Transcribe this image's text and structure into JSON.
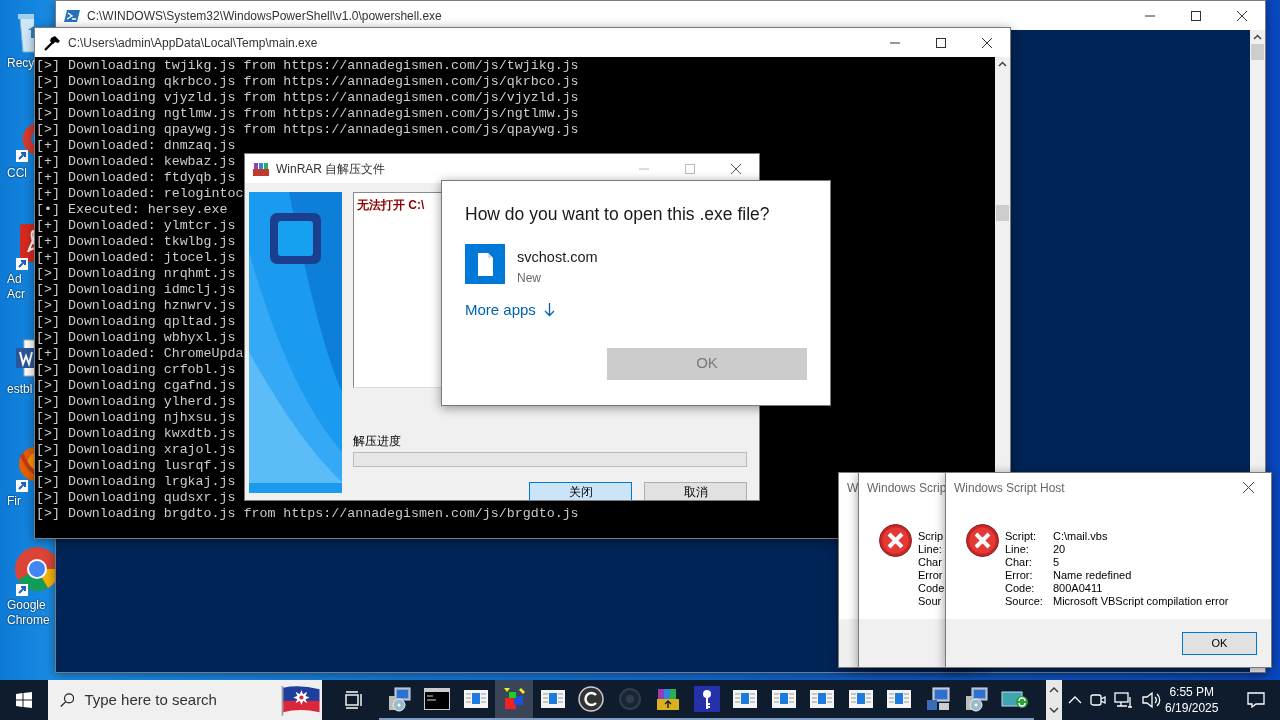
{
  "desktop_icons": [
    {
      "kind": "recycle-bin",
      "lines": [
        "Recy"
      ]
    },
    {
      "kind": "cleaner",
      "lines": [
        "CCl"
      ]
    },
    {
      "kind": "pdf",
      "lines": [
        "Ad",
        "Acr"
      ]
    },
    {
      "kind": "document",
      "lines": [
        "estbl"
      ]
    },
    {
      "kind": "fox",
      "lines": [
        "Fir"
      ]
    },
    {
      "kind": "browser",
      "lines": [
        "Google",
        "Chrome"
      ]
    }
  ],
  "powershell_window": {
    "title": "C:\\WINDOWS\\System32\\WindowsPowerShell\\v1.0\\powershell.exe"
  },
  "console_window": {
    "title": "C:\\Users\\admin\\AppData\\Local\\Temp\\main.exe",
    "lines": [
      "[>] Downloading twjikg.js from https://annadegismen.com/js/twjikg.js",
      "[>] Downloading qkrbco.js from https://annadegismen.com/js/qkrbco.js",
      "[>] Downloading vjyzld.js from https://annadegismen.com/js/vjyzld.js",
      "[>] Downloading ngtlmw.js from https://annadegismen.com/js/ngtlmw.js",
      "[>] Downloading qpaywg.js from https://annadegismen.com/js/qpaywg.js",
      "[+] Downloaded: dnmzaq.js",
      "[+] Downloaded: kewbaz.js",
      "[+] Downloaded: ftdyqb.js",
      "[+] Downloaded: relogintoc",
      "[•] Executed: hersey.exe",
      "[+] Downloaded: ylmtcr.js",
      "[+] Downloaded: tkwlbg.js",
      "[+] Downloaded: jtocel.js",
      "[>] Downloading nrqhmt.js",
      "[>] Downloading idmclj.js",
      "[>] Downloading hznwrv.js",
      "[>] Downloading qpltad.js",
      "[>] Downloading wbhyxl.js",
      "[+] Downloaded: ChromeUpda",
      "[>] Downloading crfobl.js",
      "[>] Downloading cgafnd.js",
      "[>] Downloading ylherd.js",
      "[>] Downloading njhxsu.js",
      "[>] Downloading kwxdtb.js",
      "[>] Downloading xrajol.js",
      "[>] Downloading lusrqf.js",
      "[>] Downloading lrgkaj.js",
      "[>] Downloading qudsxr.js",
      "[>] Downloading brgdto.js from https://annadegismen.com/js/brgdto.js"
    ]
  },
  "winrar_window": {
    "title": "WinRAR 自解压文件",
    "log_text": "无法打开 C:\\",
    "progress_label": "解压进度",
    "progress": {
      "level": 0
    },
    "buttons": [
      {
        "label": "关闭",
        "default": true
      },
      {
        "label": "取消",
        "default": false
      }
    ]
  },
  "open_with_dialog": {
    "title": "How do you want to open this .exe file?",
    "app": {
      "name": "svchost.com",
      "note": "New"
    },
    "more_apps": "More apps",
    "ok_button": {
      "label": "OK",
      "disabled": true
    }
  },
  "script_host_dialogs": [
    {
      "title": "W"
    },
    {
      "title": "Windows Scrip",
      "fields": [
        {
          "label": "Scrip"
        },
        {
          "label": "Line:"
        },
        {
          "label": "Char"
        },
        {
          "label": "Error"
        },
        {
          "label": "Code"
        },
        {
          "label": "Sour"
        }
      ]
    },
    {
      "title": "Windows Script Host",
      "fields": [
        {
          "label": "Script:",
          "value": "C:\\mail.vbs"
        },
        {
          "label": "Line:",
          "value": "20"
        },
        {
          "label": "Char:",
          "value": "5"
        },
        {
          "label": "Error:",
          "value": "Name redefined"
        },
        {
          "label": "Code:",
          "value": "800A0411"
        },
        {
          "label": "Source:",
          "value": "Microsoft VBScript compilation error"
        }
      ],
      "ok_button": "OK"
    }
  ],
  "taskbar": {
    "search": {
      "placeholder": "Type here to search"
    },
    "apps": [
      {
        "kind": "installer",
        "selected": false
      },
      {
        "kind": "console",
        "selected": false
      },
      {
        "kind": "window",
        "selected": false
      },
      {
        "kind": "shapes",
        "selected": true
      },
      {
        "kind": "window",
        "selected": false
      },
      {
        "kind": "disc",
        "selected": false
      },
      {
        "kind": "dark",
        "selected": false
      },
      {
        "kind": "archive",
        "selected": false
      },
      {
        "kind": "key",
        "selected": false
      },
      {
        "kind": "window",
        "selected": false
      },
      {
        "kind": "window",
        "selected": false
      },
      {
        "kind": "window",
        "selected": false
      },
      {
        "kind": "window",
        "selected": false
      },
      {
        "kind": "window",
        "selected": false
      },
      {
        "kind": "pc-setup",
        "selected": false
      },
      {
        "kind": "installer",
        "selected": false
      },
      {
        "kind": "network",
        "selected": false
      }
    ],
    "clock": {
      "time": "6:55 PM",
      "date": "6/19/2025"
    }
  }
}
